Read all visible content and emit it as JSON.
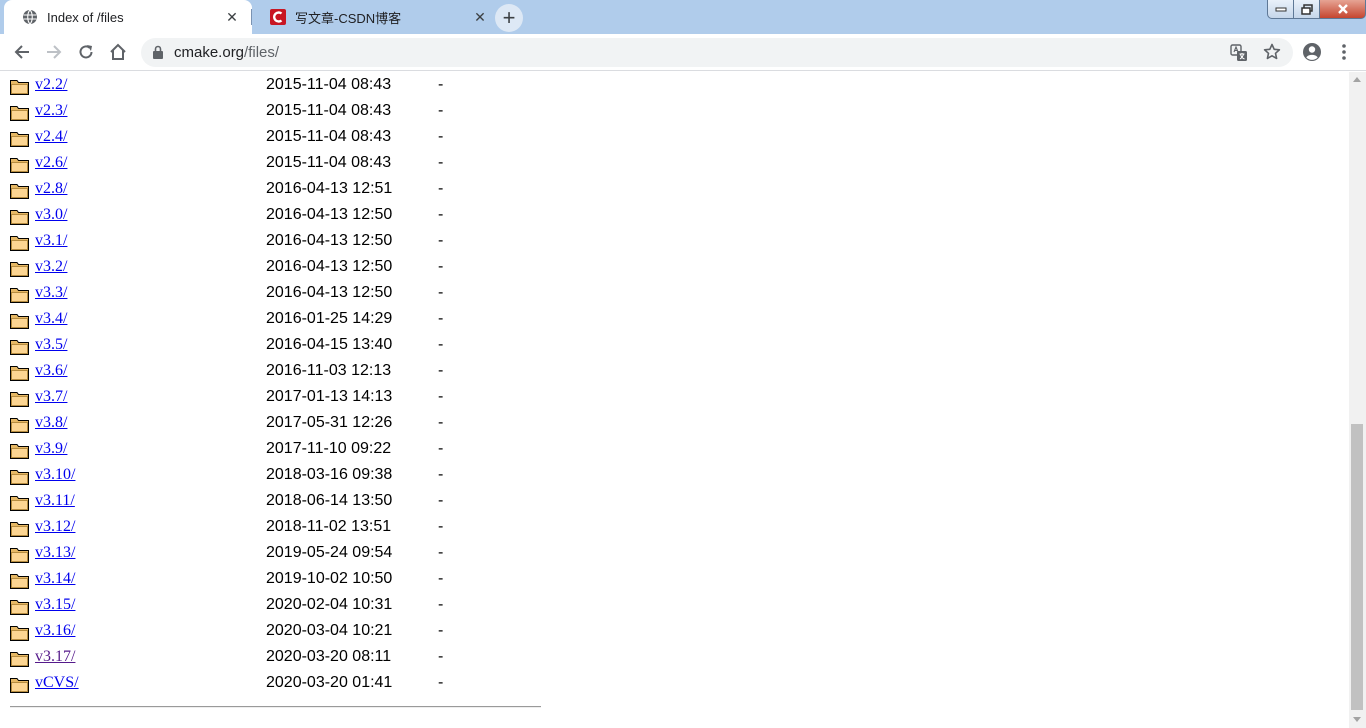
{
  "tabs": [
    {
      "title": "Index of /files",
      "active": true,
      "icon": "globe-icon"
    },
    {
      "title": "写文章-CSDN博客",
      "active": false,
      "icon": "csdn-logo-icon",
      "brand_color": "#c81623"
    }
  ],
  "tab_close_glyph": "✕",
  "new_tab_glyph": "+",
  "address_bar": {
    "host": "cmake.org",
    "path": "/files/"
  },
  "listing": [
    {
      "name": "v2.2/",
      "modified": "2015-11-04 08:43",
      "size": "-"
    },
    {
      "name": "v2.3/",
      "modified": "2015-11-04 08:43",
      "size": "-"
    },
    {
      "name": "v2.4/",
      "modified": "2015-11-04 08:43",
      "size": "-"
    },
    {
      "name": "v2.6/",
      "modified": "2015-11-04 08:43",
      "size": "-"
    },
    {
      "name": "v2.8/",
      "modified": "2016-04-13 12:51",
      "size": "-"
    },
    {
      "name": "v3.0/",
      "modified": "2016-04-13 12:50",
      "size": "-"
    },
    {
      "name": "v3.1/",
      "modified": "2016-04-13 12:50",
      "size": "-"
    },
    {
      "name": "v3.2/",
      "modified": "2016-04-13 12:50",
      "size": "-"
    },
    {
      "name": "v3.3/",
      "modified": "2016-04-13 12:50",
      "size": "-"
    },
    {
      "name": "v3.4/",
      "modified": "2016-01-25 14:29",
      "size": "-"
    },
    {
      "name": "v3.5/",
      "modified": "2016-04-15 13:40",
      "size": "-"
    },
    {
      "name": "v3.6/",
      "modified": "2016-11-03 12:13",
      "size": "-"
    },
    {
      "name": "v3.7/",
      "modified": "2017-01-13 14:13",
      "size": "-"
    },
    {
      "name": "v3.8/",
      "modified": "2017-05-31 12:26",
      "size": "-"
    },
    {
      "name": "v3.9/",
      "modified": "2017-11-10 09:22",
      "size": "-"
    },
    {
      "name": "v3.10/",
      "modified": "2018-03-16 09:38",
      "size": "-"
    },
    {
      "name": "v3.11/",
      "modified": "2018-06-14 13:50",
      "size": "-"
    },
    {
      "name": "v3.12/",
      "modified": "2018-11-02 13:51",
      "size": "-"
    },
    {
      "name": "v3.13/",
      "modified": "2019-05-24 09:54",
      "size": "-"
    },
    {
      "name": "v3.14/",
      "modified": "2019-10-02 10:50",
      "size": "-"
    },
    {
      "name": "v3.15/",
      "modified": "2020-02-04 10:31",
      "size": "-"
    },
    {
      "name": "v3.16/",
      "modified": "2020-03-04 10:21",
      "size": "-"
    },
    {
      "name": "v3.17/",
      "modified": "2020-03-20 08:11",
      "size": "-",
      "visited": true
    },
    {
      "name": "vCVS/",
      "modified": "2020-03-20 01:41",
      "size": "-"
    }
  ],
  "colors": {
    "link": "#0000ee",
    "visited_link": "#551a8b",
    "titlebar": "#b0cceb"
  }
}
